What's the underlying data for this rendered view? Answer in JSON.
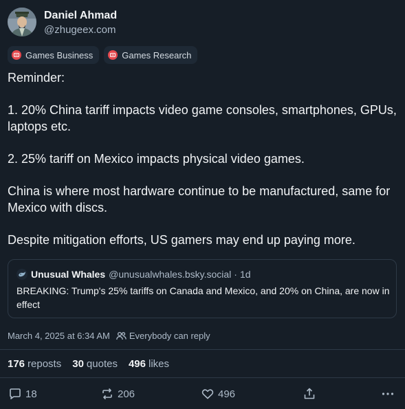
{
  "author": {
    "display_name": "Daniel Ahmad",
    "handle": "@zhugeex.com",
    "avatar_icon": "portrait-avatar"
  },
  "feeds": [
    {
      "label": "Games Business",
      "icon": "feed-icon",
      "color": "#e5484d"
    },
    {
      "label": "Games Research",
      "icon": "feed-icon",
      "color": "#e5484d"
    }
  ],
  "post": {
    "paragraphs": [
      "Reminder:",
      "1. 20% China tariff impacts video game consoles, smartphones, GPUs, laptops etc.",
      "2. 25% tariff on Mexico impacts physical video games.",
      "China is where most hardware continue to be manufactured, same for Mexico with discs.",
      "Despite mitigation efforts, US gamers may end up paying more."
    ]
  },
  "quote": {
    "name": "Unusual Whales",
    "handle": "@unusualwhales.bsky.social",
    "separator": "·",
    "time": "1d",
    "text": "BREAKING: Trump's 25% tariffs on Canada and Mexico, and 20% on China, are now in effect"
  },
  "meta": {
    "timestamp": "March 4, 2025 at 6:34 AM",
    "reply_setting": "Everybody can reply"
  },
  "stats": {
    "reposts_count": "176",
    "reposts_label": "reposts",
    "quotes_count": "30",
    "quotes_label": "quotes",
    "likes_count": "496",
    "likes_label": "likes"
  },
  "actions": {
    "reply_count": "18",
    "repost_count": "206",
    "like_count": "496"
  },
  "colors": {
    "background": "#161e27",
    "text": "#f1f3f5",
    "muted": "#aebbc9",
    "border": "#2e3a47",
    "feed_accent": "#e5484d"
  }
}
